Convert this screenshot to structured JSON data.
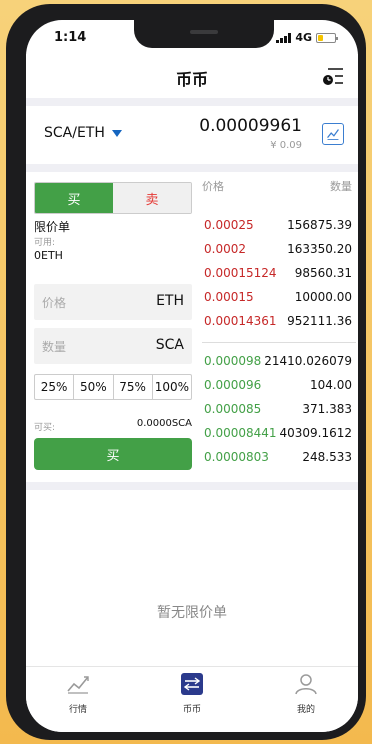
{
  "status_bar": {
    "time": "1:14",
    "network": "4G"
  },
  "nav": {
    "title": "币币"
  },
  "pair": {
    "name": "SCA/ETH",
    "price": "0.00009961",
    "price_sub": "¥ 0.09"
  },
  "trade": {
    "tab_buy": "买",
    "tab_sell": "卖",
    "order_type": "限价单",
    "available_label": "可用:",
    "available_value": "0ETH",
    "price_placeholder": "价格",
    "price_unit": "ETH",
    "amount_placeholder": "数量",
    "amount_unit": "SCA",
    "percents": [
      "25%",
      "50%",
      "75%",
      "100%"
    ],
    "can_buy_label": "可买:",
    "can_buy_value": "0.0000SCA",
    "buy_button": "买"
  },
  "orderbook": {
    "header_price": "价格",
    "header_amount": "数量",
    "asks": [
      {
        "price": "0.00025",
        "amount": "156875.39"
      },
      {
        "price": "0.0002",
        "amount": "163350.20"
      },
      {
        "price": "0.00015124",
        "amount": "98560.31"
      },
      {
        "price": "0.00015",
        "amount": "10000.00"
      },
      {
        "price": "0.00014361",
        "amount": "952111.36"
      }
    ],
    "bids": [
      {
        "price": "0.000098",
        "amount": "21410.026079"
      },
      {
        "price": "0.000096",
        "amount": "104.00"
      },
      {
        "price": "0.000085",
        "amount": "371.383"
      },
      {
        "price": "0.00008441",
        "amount": "40309.1612"
      },
      {
        "price": "0.0000803",
        "amount": "248.533"
      }
    ]
  },
  "empty_state": {
    "text": "暂无限价单"
  },
  "tabbar": {
    "items": [
      {
        "label": "行情",
        "icon": "chart-line-icon"
      },
      {
        "label": "币币",
        "icon": "exchange-icon"
      },
      {
        "label": "我的",
        "icon": "user-icon"
      }
    ]
  },
  "colors": {
    "buy_green": "#43a047",
    "sell_red": "#c62828",
    "accent_blue": "#1565c0",
    "battery": "#f5c400"
  }
}
